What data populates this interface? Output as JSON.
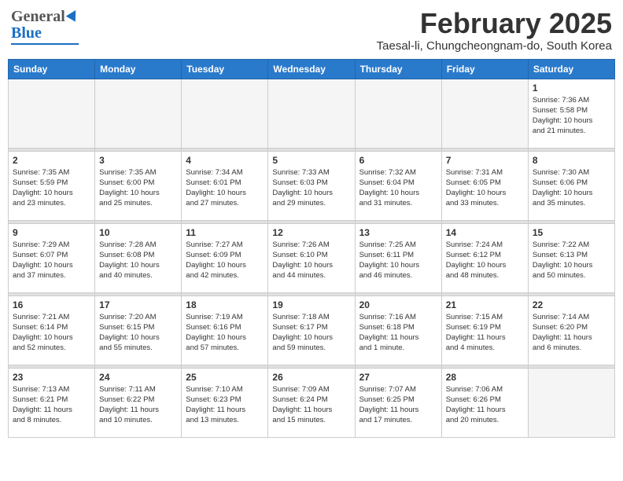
{
  "header": {
    "logo_general": "General",
    "logo_blue": "Blue",
    "month": "February 2025",
    "location": "Taesal-li, Chungcheongnam-do, South Korea"
  },
  "weekdays": [
    "Sunday",
    "Monday",
    "Tuesday",
    "Wednesday",
    "Thursday",
    "Friday",
    "Saturday"
  ],
  "weeks": [
    [
      {
        "day": "",
        "info": ""
      },
      {
        "day": "",
        "info": ""
      },
      {
        "day": "",
        "info": ""
      },
      {
        "day": "",
        "info": ""
      },
      {
        "day": "",
        "info": ""
      },
      {
        "day": "",
        "info": ""
      },
      {
        "day": "1",
        "info": "Sunrise: 7:36 AM\nSunset: 5:58 PM\nDaylight: 10 hours\nand 21 minutes."
      }
    ],
    [
      {
        "day": "2",
        "info": "Sunrise: 7:35 AM\nSunset: 5:59 PM\nDaylight: 10 hours\nand 23 minutes."
      },
      {
        "day": "3",
        "info": "Sunrise: 7:35 AM\nSunset: 6:00 PM\nDaylight: 10 hours\nand 25 minutes."
      },
      {
        "day": "4",
        "info": "Sunrise: 7:34 AM\nSunset: 6:01 PM\nDaylight: 10 hours\nand 27 minutes."
      },
      {
        "day": "5",
        "info": "Sunrise: 7:33 AM\nSunset: 6:03 PM\nDaylight: 10 hours\nand 29 minutes."
      },
      {
        "day": "6",
        "info": "Sunrise: 7:32 AM\nSunset: 6:04 PM\nDaylight: 10 hours\nand 31 minutes."
      },
      {
        "day": "7",
        "info": "Sunrise: 7:31 AM\nSunset: 6:05 PM\nDaylight: 10 hours\nand 33 minutes."
      },
      {
        "day": "8",
        "info": "Sunrise: 7:30 AM\nSunset: 6:06 PM\nDaylight: 10 hours\nand 35 minutes."
      }
    ],
    [
      {
        "day": "9",
        "info": "Sunrise: 7:29 AM\nSunset: 6:07 PM\nDaylight: 10 hours\nand 37 minutes."
      },
      {
        "day": "10",
        "info": "Sunrise: 7:28 AM\nSunset: 6:08 PM\nDaylight: 10 hours\nand 40 minutes."
      },
      {
        "day": "11",
        "info": "Sunrise: 7:27 AM\nSunset: 6:09 PM\nDaylight: 10 hours\nand 42 minutes."
      },
      {
        "day": "12",
        "info": "Sunrise: 7:26 AM\nSunset: 6:10 PM\nDaylight: 10 hours\nand 44 minutes."
      },
      {
        "day": "13",
        "info": "Sunrise: 7:25 AM\nSunset: 6:11 PM\nDaylight: 10 hours\nand 46 minutes."
      },
      {
        "day": "14",
        "info": "Sunrise: 7:24 AM\nSunset: 6:12 PM\nDaylight: 10 hours\nand 48 minutes."
      },
      {
        "day": "15",
        "info": "Sunrise: 7:22 AM\nSunset: 6:13 PM\nDaylight: 10 hours\nand 50 minutes."
      }
    ],
    [
      {
        "day": "16",
        "info": "Sunrise: 7:21 AM\nSunset: 6:14 PM\nDaylight: 10 hours\nand 52 minutes."
      },
      {
        "day": "17",
        "info": "Sunrise: 7:20 AM\nSunset: 6:15 PM\nDaylight: 10 hours\nand 55 minutes."
      },
      {
        "day": "18",
        "info": "Sunrise: 7:19 AM\nSunset: 6:16 PM\nDaylight: 10 hours\nand 57 minutes."
      },
      {
        "day": "19",
        "info": "Sunrise: 7:18 AM\nSunset: 6:17 PM\nDaylight: 10 hours\nand 59 minutes."
      },
      {
        "day": "20",
        "info": "Sunrise: 7:16 AM\nSunset: 6:18 PM\nDaylight: 11 hours\nand 1 minute."
      },
      {
        "day": "21",
        "info": "Sunrise: 7:15 AM\nSunset: 6:19 PM\nDaylight: 11 hours\nand 4 minutes."
      },
      {
        "day": "22",
        "info": "Sunrise: 7:14 AM\nSunset: 6:20 PM\nDaylight: 11 hours\nand 6 minutes."
      }
    ],
    [
      {
        "day": "23",
        "info": "Sunrise: 7:13 AM\nSunset: 6:21 PM\nDaylight: 11 hours\nand 8 minutes."
      },
      {
        "day": "24",
        "info": "Sunrise: 7:11 AM\nSunset: 6:22 PM\nDaylight: 11 hours\nand 10 minutes."
      },
      {
        "day": "25",
        "info": "Sunrise: 7:10 AM\nSunset: 6:23 PM\nDaylight: 11 hours\nand 13 minutes."
      },
      {
        "day": "26",
        "info": "Sunrise: 7:09 AM\nSunset: 6:24 PM\nDaylight: 11 hours\nand 15 minutes."
      },
      {
        "day": "27",
        "info": "Sunrise: 7:07 AM\nSunset: 6:25 PM\nDaylight: 11 hours\nand 17 minutes."
      },
      {
        "day": "28",
        "info": "Sunrise: 7:06 AM\nSunset: 6:26 PM\nDaylight: 11 hours\nand 20 minutes."
      },
      {
        "day": "",
        "info": ""
      }
    ]
  ]
}
